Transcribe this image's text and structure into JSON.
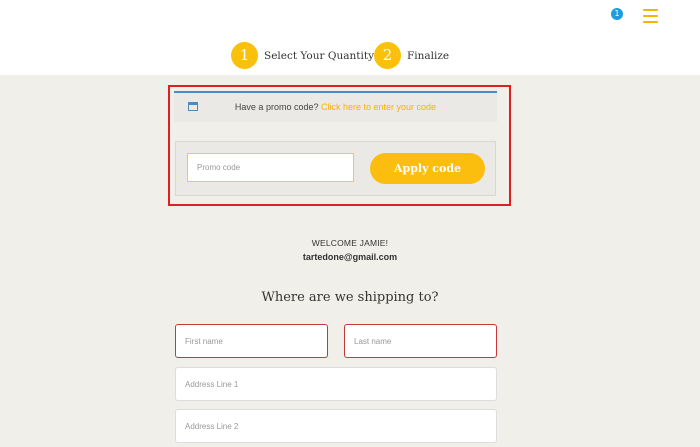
{
  "header": {
    "cart_badge_count": "1",
    "menu_icon": "hamburger-menu-icon",
    "accent_color": "#f9c10a"
  },
  "steps": [
    {
      "number": "1",
      "label": "Select Your Quantity"
    },
    {
      "number": "2",
      "label": "Finalize"
    }
  ],
  "promo": {
    "prompt": "Have a promo code?",
    "link": "Click here to enter your code",
    "input_placeholder": "Promo code",
    "input_value": "",
    "apply_label": "Apply code"
  },
  "account": {
    "welcome": "WELCOME JAMIE!",
    "email": "tartedone@gmail.com"
  },
  "shipping": {
    "title": "Where are we shipping to?",
    "first_name_placeholder": "First name",
    "last_name_placeholder": "Last name",
    "address1_placeholder": "Address Line 1",
    "address2_placeholder": "Address Line 2"
  }
}
